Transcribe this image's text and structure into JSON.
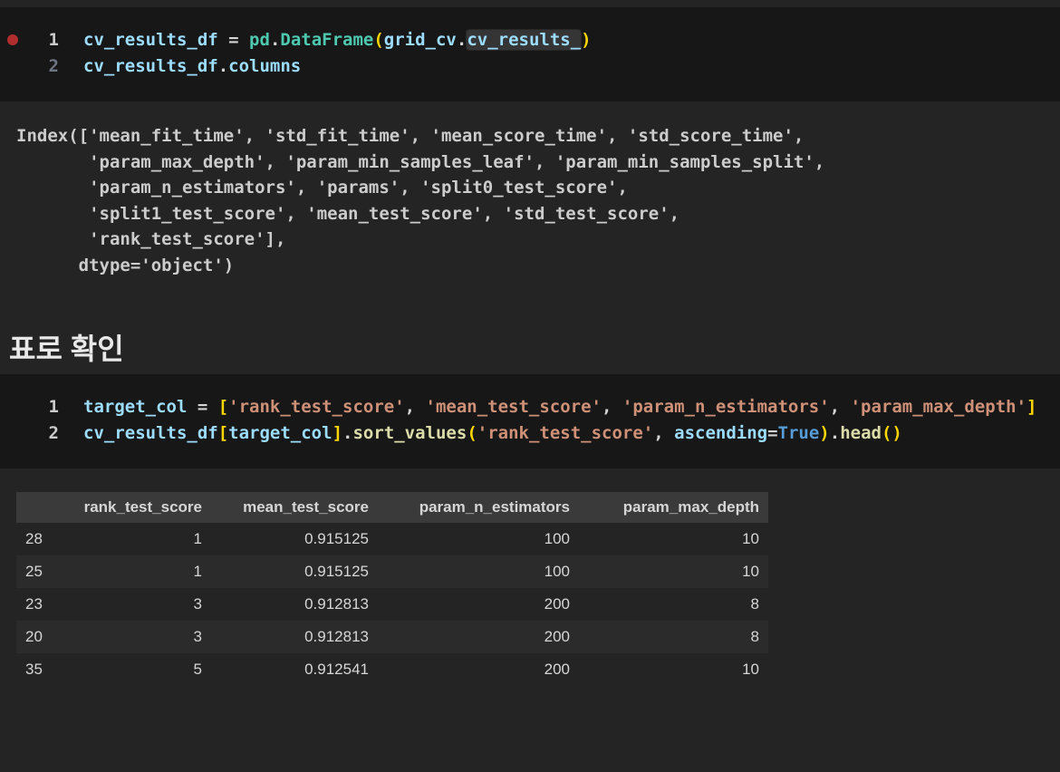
{
  "colors": {
    "page_bg": "#242424",
    "cell_bg": "#171717",
    "output_text": "#CCCCCC",
    "heading_text": "#E8E8E8",
    "table_header_bg": "#3A3A3A",
    "table_stripe_bg": "#2B2B2B",
    "table_text": "#D6D6D6",
    "breakpoint_red": "#B02E2E",
    "word_highlight_bg": "rgba(255,255,255,0.13)"
  },
  "palette": {
    "v": "#9CDCFE",
    "w": "#D4D4D4",
    "cls": "#4EC9B0",
    "fn": "#DCDCAA",
    "str": "#CE9178",
    "kw": "#569CD6",
    "b1": "#FFD700"
  },
  "cell1": {
    "line_numbers": [
      {
        "n": "1",
        "color": "#CCCCCC"
      },
      {
        "n": "2",
        "color": "#6E7681"
      }
    ],
    "lines": [
      [
        {
          "t": "cv_results_df",
          "c": "v"
        },
        {
          "t": " = ",
          "c": "w"
        },
        {
          "t": "pd",
          "c": "cls"
        },
        {
          "t": ".",
          "c": "w"
        },
        {
          "t": "DataFrame",
          "c": "cls"
        },
        {
          "t": "(",
          "c": "b1"
        },
        {
          "t": "grid_cv",
          "c": "v"
        },
        {
          "t": ".",
          "c": "w"
        },
        {
          "t": "cv_results_",
          "c": "v",
          "hl": true
        },
        {
          "t": ")",
          "c": "b1"
        }
      ],
      [
        {
          "t": "cv_results_df",
          "c": "v"
        },
        {
          "t": ".",
          "c": "w"
        },
        {
          "t": "columns",
          "c": "v"
        }
      ]
    ]
  },
  "output1": {
    "lines": [
      "Index(['mean_fit_time', 'std_fit_time', 'mean_score_time', 'std_score_time',",
      "       'param_max_depth', 'param_min_samples_leaf', 'param_min_samples_split',",
      "       'param_n_estimators', 'params', 'split0_test_score',",
      "       'split1_test_score', 'mean_test_score', 'std_test_score',",
      "       'rank_test_score'],",
      "      dtype='object')"
    ]
  },
  "heading": {
    "text": "표로 확인"
  },
  "cell2": {
    "line_numbers": [
      {
        "n": "1",
        "color": "#CCCCCC"
      },
      {
        "n": "2",
        "color": "#CCCCCC"
      }
    ],
    "lines": [
      [
        {
          "t": "target_col",
          "c": "v"
        },
        {
          "t": " = ",
          "c": "w"
        },
        {
          "t": "[",
          "c": "b1"
        },
        {
          "t": "'rank_test_score'",
          "c": "str"
        },
        {
          "t": ", ",
          "c": "w"
        },
        {
          "t": "'mean_test_score'",
          "c": "str"
        },
        {
          "t": ", ",
          "c": "w"
        },
        {
          "t": "'param_n_estimators'",
          "c": "str"
        },
        {
          "t": ", ",
          "c": "w"
        },
        {
          "t": "'param_max_depth'",
          "c": "str"
        },
        {
          "t": "]",
          "c": "b1"
        }
      ],
      [
        {
          "t": "cv_results_df",
          "c": "v"
        },
        {
          "t": "[",
          "c": "b1"
        },
        {
          "t": "target_col",
          "c": "v"
        },
        {
          "t": "]",
          "c": "b1"
        },
        {
          "t": ".",
          "c": "w"
        },
        {
          "t": "sort_values",
          "c": "fn"
        },
        {
          "t": "(",
          "c": "b1"
        },
        {
          "t": "'rank_test_score'",
          "c": "str"
        },
        {
          "t": ", ",
          "c": "w"
        },
        {
          "t": "ascending",
          "c": "v"
        },
        {
          "t": "=",
          "c": "w"
        },
        {
          "t": "True",
          "c": "kw"
        },
        {
          "t": ")",
          "c": "b1"
        },
        {
          "t": ".",
          "c": "w"
        },
        {
          "t": "head",
          "c": "fn"
        },
        {
          "t": "(",
          "c": "b1"
        },
        {
          "t": ")",
          "c": "b1"
        }
      ]
    ]
  },
  "table": {
    "columns": [
      "rank_test_score",
      "mean_test_score",
      "param_n_estimators",
      "param_max_depth"
    ],
    "rows": [
      {
        "index": "28",
        "values": [
          "1",
          "0.915125",
          "100",
          "10"
        ]
      },
      {
        "index": "25",
        "values": [
          "1",
          "0.915125",
          "100",
          "10"
        ]
      },
      {
        "index": "23",
        "values": [
          "3",
          "0.912813",
          "200",
          "8"
        ]
      },
      {
        "index": "20",
        "values": [
          "3",
          "0.912813",
          "200",
          "8"
        ]
      },
      {
        "index": "35",
        "values": [
          "5",
          "0.912541",
          "200",
          "10"
        ]
      }
    ]
  }
}
